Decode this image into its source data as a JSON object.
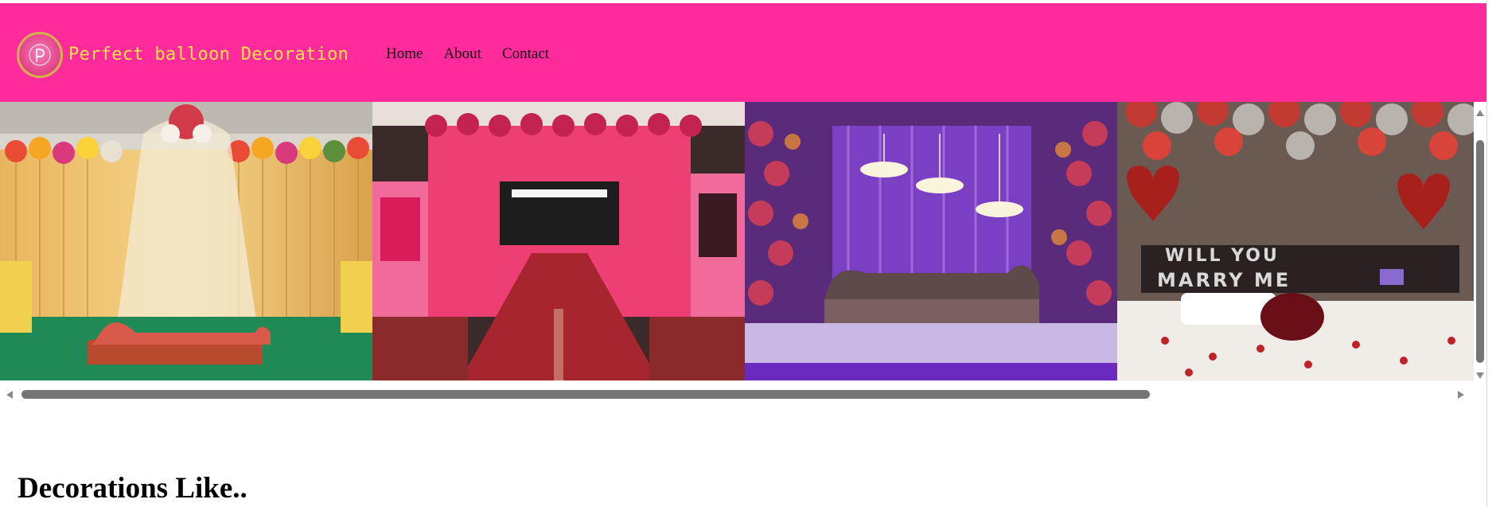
{
  "header": {
    "brand": "Perfect balloon Decoration",
    "logo_icon": "monogram-p-icon",
    "background": "#ff2a9c",
    "brand_color": "#ffe34a"
  },
  "nav": {
    "items": [
      {
        "label": "Home"
      },
      {
        "label": "About"
      },
      {
        "label": "Contact"
      }
    ]
  },
  "gallery": {
    "images": [
      {
        "subject": "stage-floral-sofa"
      },
      {
        "subject": "pink-floral-entrance"
      },
      {
        "subject": "purple-chandelier-stage"
      },
      {
        "subject": "balloon-bedroom-proposal",
        "caption": "WILL YOU MARRY ME"
      }
    ]
  },
  "section": {
    "title": "Decorations Like.."
  }
}
